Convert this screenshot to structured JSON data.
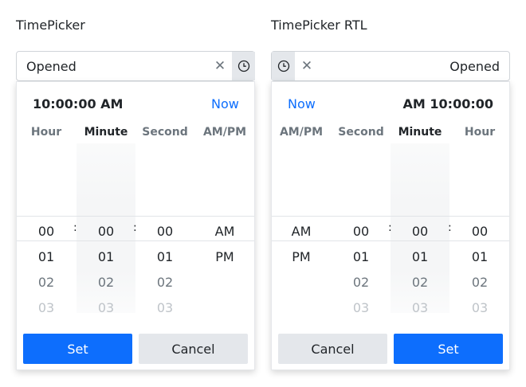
{
  "ltr": {
    "label": "TimePicker",
    "input_value": "Opened",
    "popup": {
      "title": "10:00:00 AM",
      "now_label": "Now",
      "columns": [
        "Hour",
        "Minute",
        "Second",
        "AM/PM"
      ],
      "hours": [
        "00",
        "01",
        "02",
        "03"
      ],
      "minutes": [
        "00",
        "01",
        "02",
        "03"
      ],
      "seconds": [
        "00",
        "01",
        "02",
        "03"
      ],
      "ampm": [
        "AM",
        "PM"
      ],
      "separator": ":",
      "set_label": "Set",
      "cancel_label": "Cancel"
    }
  },
  "rtl": {
    "label": "TimePicker RTL",
    "input_value": "Opened",
    "popup": {
      "title": "AM 10:00:00",
      "now_label": "Now",
      "columns": [
        "AM/PM",
        "Second",
        "Minute",
        "Hour"
      ],
      "hours": [
        "00",
        "01",
        "02",
        "03"
      ],
      "minutes": [
        "00",
        "01",
        "02",
        "03"
      ],
      "seconds": [
        "00",
        "01",
        "02",
        "03"
      ],
      "ampm": [
        "AM",
        "PM"
      ],
      "separator": ":",
      "set_label": "Set",
      "cancel_label": "Cancel"
    }
  },
  "icons": {
    "clear": "x-icon",
    "clock": "clock-icon"
  },
  "colors": {
    "primary": "#0d6efd",
    "now_link": "#0d6efd",
    "toggle_bg": "#e4e7eb"
  }
}
